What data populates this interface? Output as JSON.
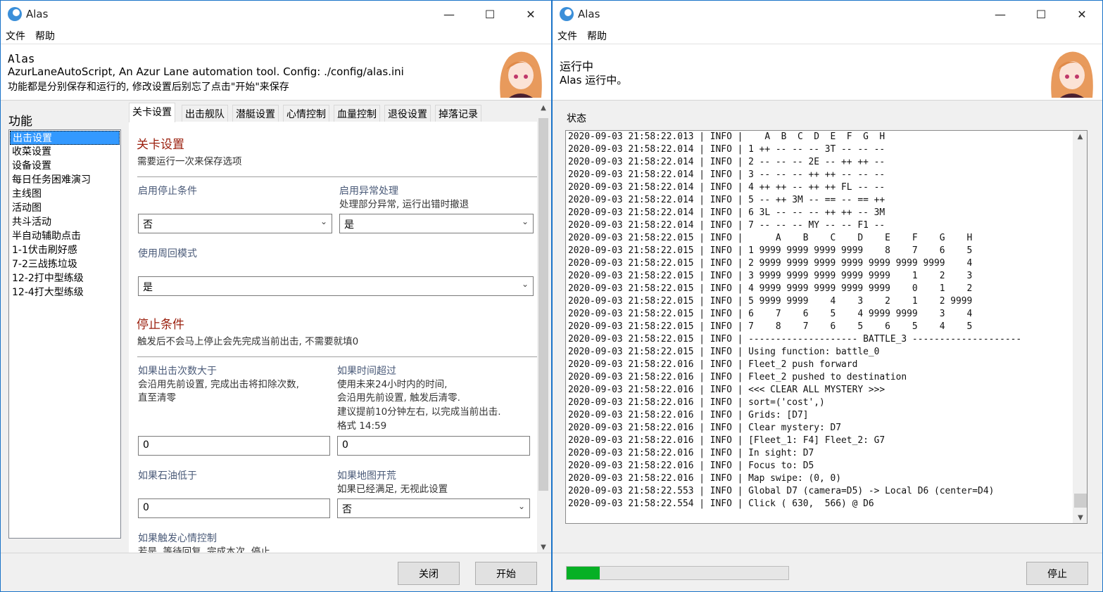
{
  "left_window": {
    "title": "Alas",
    "menu": [
      "文件",
      "帮助"
    ],
    "header": {
      "title": "Alas",
      "line1": "AzurLaneAutoScript, An Azur Lane automation tool. Config: ./config/alas.ini",
      "line2": "功能都是分别保存和运行的, 修改设置后别忘了点击\"开始\"来保存"
    },
    "sidebar_title": "功能",
    "sidebar_items": [
      "出击设置",
      "收菜设置",
      "设备设置",
      "每日任务困难演习",
      "主线图",
      "活动图",
      "共斗活动",
      "半自动辅助点击",
      "1-1伏击刷好感",
      "7-2三战拣垃圾",
      "12-2打中型练级",
      "12-4打大型练级"
    ],
    "selected_item": 0,
    "tabs": [
      "关卡设置",
      "出击舰队",
      "潜艇设置",
      "心情控制",
      "血量控制",
      "退役设置",
      "掉落记录"
    ],
    "active_tab": 0,
    "content": {
      "section1_title": "关卡设置",
      "section1_desc": "需要运行一次来保存选项",
      "enable_stop_label": "启用停止条件",
      "enable_stop_value": "否",
      "enable_exception_label": "启用异常处理",
      "enable_exception_desc": "处理部分异常, 运行出错时撤退",
      "enable_exception_value": "是",
      "loop_mode_label": "使用周回模式",
      "loop_mode_value": "是",
      "section2_title": "停止条件",
      "section2_desc": "触发后不会马上停止会先完成当前出击, 不需要就填0",
      "sortie_count_label": "如果出击次数大于",
      "sortie_count_desc1": "会沿用先前设置, 完成出击将扣除次数,",
      "sortie_count_desc2": "直至清零",
      "sortie_count_value": "0",
      "time_label": "如果时间超过",
      "time_desc1": "使用未来24小时内的时间,",
      "time_desc2": "会沿用先前设置, 触发后清零.",
      "time_desc3": "建议提前10分钟左右, 以完成当前出击.",
      "time_desc4": "格式 14:59",
      "time_value": "0",
      "oil_label": "如果石油低于",
      "oil_value": "0",
      "map_label": "如果地图开荒",
      "map_desc": "如果已经满足, 无视此设置",
      "map_value": "否",
      "mood_label": "如果触发心情控制",
      "mood_desc": "若是, 等待回复, 完成本次, 停止"
    },
    "buttons": {
      "close": "关闭",
      "start": "开始"
    }
  },
  "right_window": {
    "title": "Alas",
    "menu": [
      "文件",
      "帮助"
    ],
    "header": {
      "title": "运行中",
      "subtitle": "Alas 运行中。"
    },
    "status_label": "状态",
    "log": [
      "2020-09-03 21:58:22.013 | INFO |    A  B  C  D  E  F  G  H",
      "2020-09-03 21:58:22.014 | INFO | 1 ++ -- -- -- 3T -- -- --",
      "2020-09-03 21:58:22.014 | INFO | 2 -- -- -- 2E -- ++ ++ --",
      "2020-09-03 21:58:22.014 | INFO | 3 -- -- -- ++ ++ -- -- --",
      "2020-09-03 21:58:22.014 | INFO | 4 ++ ++ -- ++ ++ FL -- --",
      "2020-09-03 21:58:22.014 | INFO | 5 -- ++ 3M -- == -- == ++",
      "2020-09-03 21:58:22.014 | INFO | 6 3L -- -- -- ++ ++ -- 3M",
      "2020-09-03 21:58:22.014 | INFO | 7 -- -- -- MY -- -- F1 --",
      "2020-09-03 21:58:22.015 | INFO |      A    B    C    D    E    F    G    H",
      "2020-09-03 21:58:22.015 | INFO | 1 9999 9999 9999 9999    8    7    6    5",
      "2020-09-03 21:58:22.015 | INFO | 2 9999 9999 9999 9999 9999 9999 9999    4",
      "2020-09-03 21:58:22.015 | INFO | 3 9999 9999 9999 9999 9999    1    2    3",
      "2020-09-03 21:58:22.015 | INFO | 4 9999 9999 9999 9999 9999    0    1    2",
      "2020-09-03 21:58:22.015 | INFO | 5 9999 9999    4    3    2    1    2 9999",
      "2020-09-03 21:58:22.015 | INFO | 6    7    6    5    4 9999 9999    3    4",
      "2020-09-03 21:58:22.015 | INFO | 7    8    7    6    5    6    5    4    5",
      "2020-09-03 21:58:22.015 | INFO | -------------------- BATTLE_3 --------------------",
      "2020-09-03 21:58:22.015 | INFO | Using function: battle_0",
      "2020-09-03 21:58:22.016 | INFO | Fleet_2 push forward",
      "2020-09-03 21:58:22.016 | INFO | Fleet_2 pushed to destination",
      "2020-09-03 21:58:22.016 | INFO | <<< CLEAR ALL MYSTERY >>>",
      "2020-09-03 21:58:22.016 | INFO | sort=('cost',)",
      "2020-09-03 21:58:22.016 | INFO | Grids: [D7]",
      "2020-09-03 21:58:22.016 | INFO | Clear mystery: D7",
      "2020-09-03 21:58:22.016 | INFO | [Fleet_1: F4] Fleet_2: G7",
      "2020-09-03 21:58:22.016 | INFO | In sight: D7",
      "2020-09-03 21:58:22.016 | INFO | Focus to: D5",
      "2020-09-03 21:58:22.016 | INFO | Map swipe: (0, 0)",
      "2020-09-03 21:58:22.553 | INFO | Global D7 (camera=D5) -> Local D6 (center=D4)",
      "2020-09-03 21:58:22.554 | INFO | Click ( 630,  566) @ D6"
    ],
    "progress_percent": 15,
    "progress_color": "#06b025",
    "buttons": {
      "stop": "停止"
    }
  },
  "icons": {
    "logo": "alas-logo-icon",
    "minimize": "minimize-icon",
    "maximize": "maximize-icon",
    "close": "close-icon",
    "dropdown": "chevron-down-icon"
  }
}
